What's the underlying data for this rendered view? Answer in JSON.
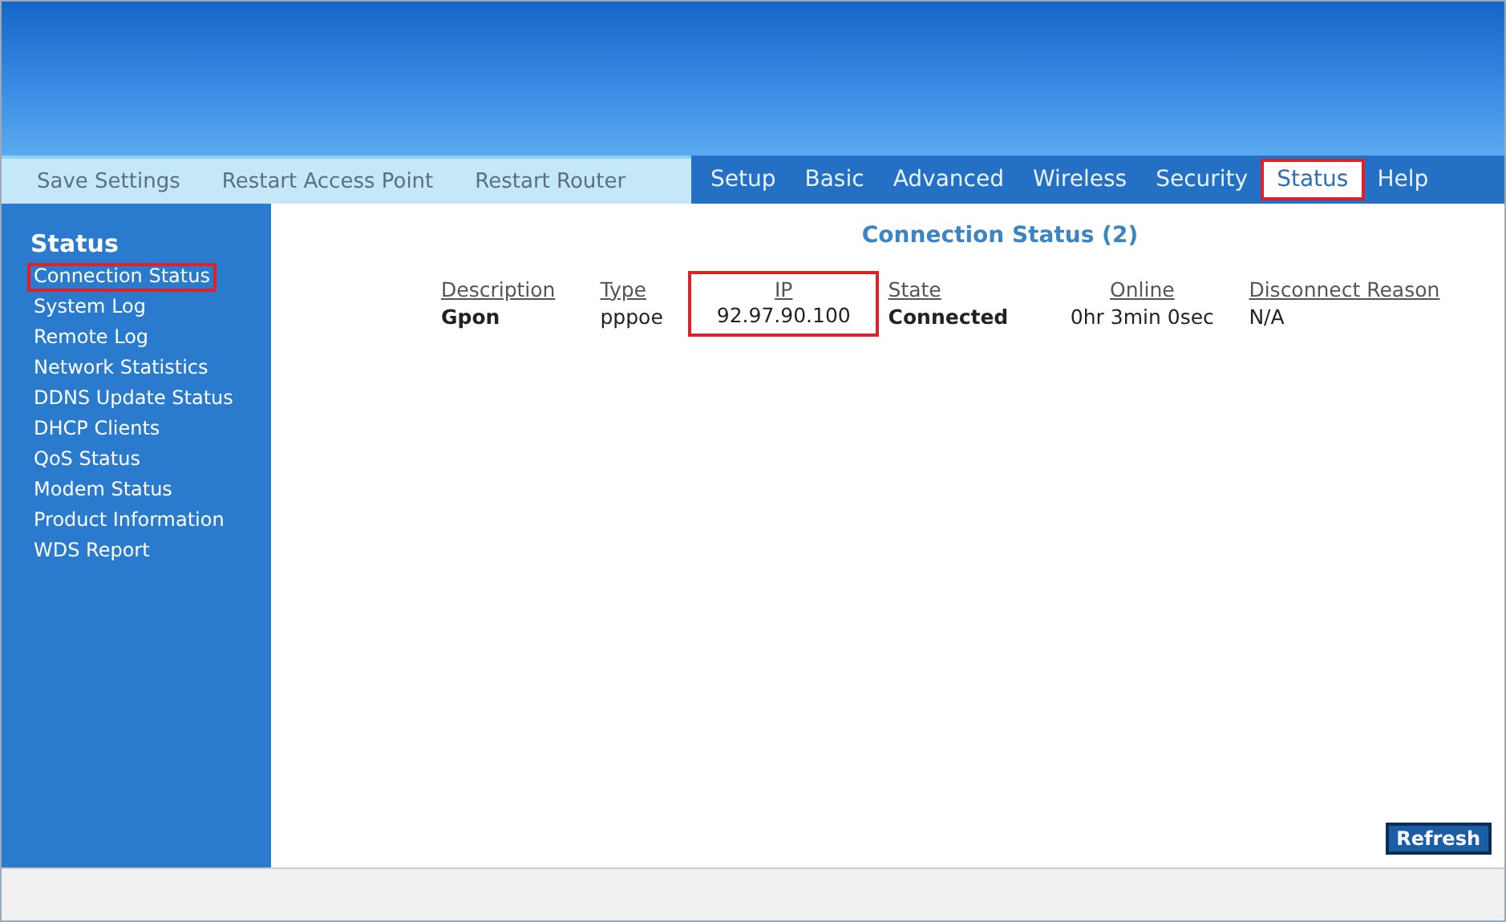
{
  "actions": [
    {
      "label": "Save Settings"
    },
    {
      "label": "Restart Access Point"
    },
    {
      "label": "Restart Router"
    }
  ],
  "tabs": [
    {
      "label": "Setup",
      "selected": false,
      "highlighted": false
    },
    {
      "label": "Basic",
      "selected": false,
      "highlighted": false
    },
    {
      "label": "Advanced",
      "selected": false,
      "highlighted": false
    },
    {
      "label": "Wireless",
      "selected": false,
      "highlighted": false
    },
    {
      "label": "Security",
      "selected": false,
      "highlighted": false
    },
    {
      "label": "Status",
      "selected": true,
      "highlighted": true
    },
    {
      "label": "Help",
      "selected": false,
      "highlighted": false
    }
  ],
  "sidebar": {
    "title": "Status",
    "items": [
      {
        "label": "Connection Status",
        "highlighted": true
      },
      {
        "label": "System Log",
        "highlighted": false
      },
      {
        "label": "Remote Log",
        "highlighted": false
      },
      {
        "label": "Network Statistics",
        "highlighted": false
      },
      {
        "label": "DDNS Update Status",
        "highlighted": false
      },
      {
        "label": "DHCP Clients",
        "highlighted": false
      },
      {
        "label": "QoS Status",
        "highlighted": false
      },
      {
        "label": "Modem Status",
        "highlighted": false
      },
      {
        "label": "Product Information",
        "highlighted": false
      },
      {
        "label": "WDS Report",
        "highlighted": false
      }
    ]
  },
  "table": {
    "title": "Connection Status (2)",
    "columns": [
      {
        "label": "Description",
        "highlighted": false
      },
      {
        "label": "Type",
        "highlighted": false
      },
      {
        "label": "IP",
        "highlighted": true
      },
      {
        "label": "State",
        "highlighted": false
      },
      {
        "label": "Online",
        "highlighted": false
      },
      {
        "label": "Disconnect Reason",
        "highlighted": false
      }
    ],
    "rows": [
      [
        "Gpon",
        "pppoe",
        "92.97.90.100",
        "Connected",
        "0hr 3min 0sec",
        "N/A"
      ]
    ]
  },
  "refresh_button": "Refresh"
}
